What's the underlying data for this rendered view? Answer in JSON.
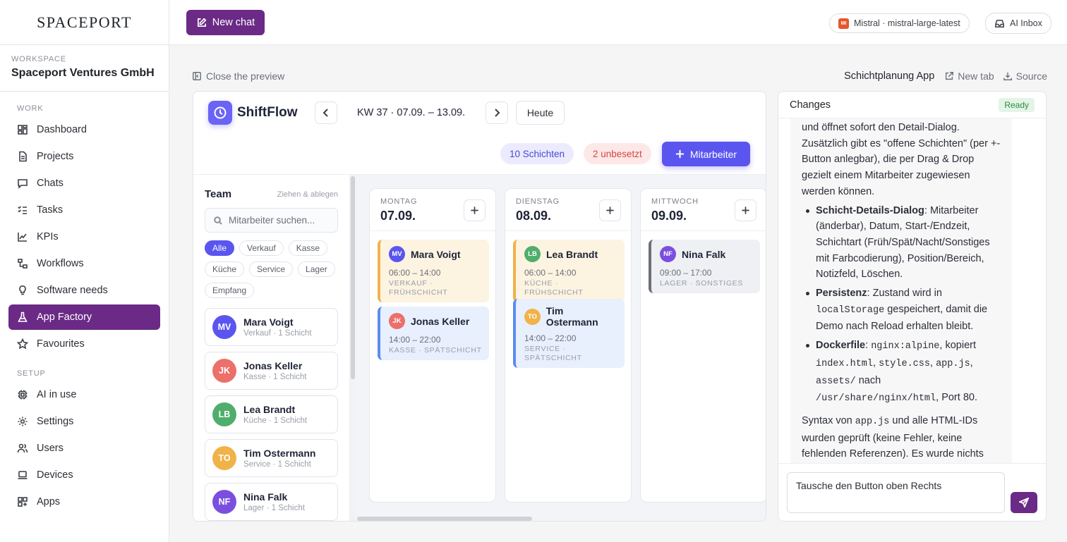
{
  "sidebar": {
    "logo": "SPACEPORT",
    "workspace_label": "WORKSPACE",
    "workspace_name": "Spaceport Ventures GmbH",
    "section_work": "WORK",
    "section_setup": "SETUP",
    "work_items": [
      {
        "label": "Dashboard",
        "icon": "dashboard-icon"
      },
      {
        "label": "Projects",
        "icon": "document-icon"
      },
      {
        "label": "Chats",
        "icon": "chat-icon"
      },
      {
        "label": "Tasks",
        "icon": "checklist-icon"
      },
      {
        "label": "KPIs",
        "icon": "line-chart-icon"
      },
      {
        "label": "Workflows",
        "icon": "workflow-icon"
      },
      {
        "label": "Software needs",
        "icon": "lightbulb-icon"
      },
      {
        "label": "App Factory",
        "icon": "flask-icon",
        "active": true
      },
      {
        "label": "Favourites",
        "icon": "star-icon"
      }
    ],
    "setup_items": [
      {
        "label": "AI in use",
        "icon": "chip-icon"
      },
      {
        "label": "Settings",
        "icon": "gear-icon"
      },
      {
        "label": "Users",
        "icon": "users-icon"
      },
      {
        "label": "Devices",
        "icon": "laptop-icon"
      },
      {
        "label": "Apps",
        "icon": "apps-icon"
      }
    ]
  },
  "topbar": {
    "new_chat": "New chat",
    "model_badge": "MI",
    "model": "Mistral · mistral-large-latest",
    "inbox": "AI Inbox"
  },
  "preview": {
    "close": "Close the preview",
    "title": "Schichtplanung App",
    "new_tab": "New tab",
    "source": "Source"
  },
  "app": {
    "brand": "ShiftFlow",
    "week": "KW 37 · 07.09. – 13.09.",
    "today": "Heute",
    "shifts_badge": "10 Schichten",
    "open_badge": "2 unbesetzt",
    "add_employee": "Mitarbeiter",
    "team_title": "Team",
    "team_hint": "Ziehen & ablegen",
    "search_placeholder": "Mitarbeiter suchen...",
    "filters": [
      "Alle",
      "Verkauf",
      "Kasse",
      "Küche",
      "Service",
      "Lager",
      "Empfang"
    ],
    "members": [
      {
        "initials": "MV",
        "name": "Mara Voigt",
        "sub": "Verkauf · 1 Schicht",
        "color": "#5b55f0"
      },
      {
        "initials": "JK",
        "name": "Jonas Keller",
        "sub": "Kasse · 1 Schicht",
        "color": "#ec6f6a"
      },
      {
        "initials": "LB",
        "name": "Lea Brandt",
        "sub": "Küche · 1 Schicht",
        "color": "#4fae6c"
      },
      {
        "initials": "TO",
        "name": "Tim Ostermann",
        "sub": "Service · 1 Schicht",
        "color": "#f1b24a"
      },
      {
        "initials": "NF",
        "name": "Nina Falk",
        "sub": "Lager · 1 Schicht",
        "color": "#7a4fe0"
      }
    ],
    "days": [
      {
        "name": "MONTAG",
        "date": "07.09.",
        "shifts": [
          {
            "initials": "MV",
            "name": "Mara Voigt",
            "time": "06:00 – 14:00",
            "desc": "VERKAUF · FRÜHSCHICHT",
            "avatar": "#5b55f0",
            "bg": "#fdf3e1",
            "bar": "#f1b24a"
          },
          {
            "initials": "JK",
            "name": "Jonas Keller",
            "time": "14:00 – 22:00",
            "desc": "KASSE · SPÄTSCHICHT",
            "avatar": "#ec6f6a",
            "bg": "#e8effd",
            "bar": "#5b8def"
          }
        ]
      },
      {
        "name": "DIENSTAG",
        "date": "08.09.",
        "shifts": [
          {
            "initials": "LB",
            "name": "Lea Brandt",
            "time": "06:00 – 14:00",
            "desc": "KÜCHE · FRÜHSCHICHT",
            "avatar": "#4fae6c",
            "bg": "#fdf3e1",
            "bar": "#f1b24a"
          },
          {
            "initials": "TO",
            "name": "Tim Ostermann",
            "time": "14:00 – 22:00",
            "desc": "SERVICE · SPÄTSCHICHT",
            "avatar": "#f1b24a",
            "bg": "#e8effd",
            "bar": "#5b8def"
          }
        ]
      },
      {
        "name": "MITTWOCH",
        "date": "09.09.",
        "shifts": [
          {
            "initials": "NF",
            "name": "Nina Falk",
            "time": "09:00 – 17:00",
            "desc": "LAGER · SONSTIGES",
            "avatar": "#7a4fe0",
            "bg": "#eef0f3",
            "bar": "#6b7079"
          }
        ]
      }
    ]
  },
  "changes": {
    "title": "Changes",
    "status": "Ready",
    "intro": "und öffnet sofort den Detail-Dialog. Zusätzlich gibt es \"offene Schichten\" (per +-Button anlegbar), die per Drag & Drop gezielt einem Mitarbeiter zugewiesen werden können.",
    "b1_title": "Schicht-Details-Dialog",
    "b1_text": ": Mitarbeiter (änderbar), Datum, Start-/Endzeit, Schichtart (Früh/Spät/Nacht/Sonstiges mit Farbcodierung), Position/Bereich, Notizfeld, Löschen.",
    "b2_title": "Persistenz",
    "b2_text1": ": Zustand wird in ",
    "b2_code": "localStorage",
    "b2_text2": " gespeichert, damit die Demo nach Reload erhalten bleibt.",
    "b3_title": "Dockerfile",
    "b3_text1": ": ",
    "b3_code1": "nginx:alpine",
    "b3_text2": ", kopiert ",
    "b3_code2": "index.html",
    "b3_text3": ", ",
    "b3_code3": "style.css",
    "b3_text4": ", ",
    "b3_code4": "app.js",
    "b3_text5": ", ",
    "b3_code5": "assets/",
    "b3_text6": " nach ",
    "b3_code6": "/usr/share/nginx/html",
    "b3_text7": ", Port 80.",
    "outro1": "Syntax von ",
    "outro_code": "app.js",
    "outro2": " und alle HTML-IDs wurden geprüft (keine Fehler, keine fehlenden Referenzen). Es wurde nichts gestartet oder gebaut – nur Dateien",
    "input": "Tausche den Button oben Rechts"
  }
}
